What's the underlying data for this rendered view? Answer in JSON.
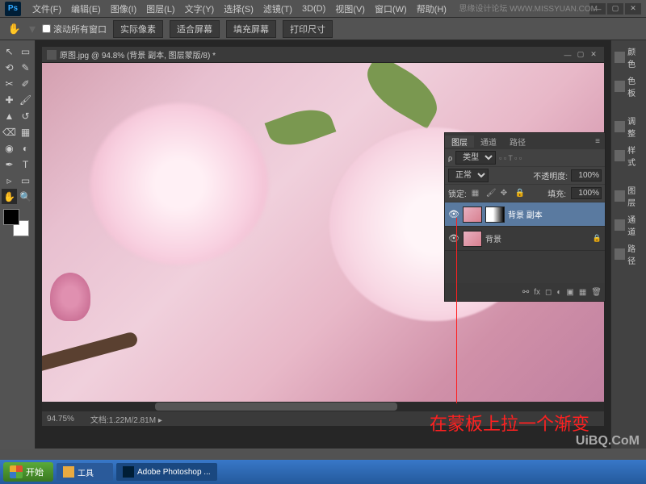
{
  "app": {
    "logo": "Ps"
  },
  "menu": {
    "file": "文件(F)",
    "edit": "编辑(E)",
    "image": "图像(I)",
    "layer": "图层(L)",
    "type": "文字(Y)",
    "select": "选择(S)",
    "filter": "滤镜(T)",
    "threed": "3D(D)",
    "view": "视图(V)",
    "window": "窗口(W)",
    "help": "帮助(H)"
  },
  "watermark_top": "思缘设计论坛 WWW.MISSYUAN.COM",
  "options": {
    "scroll_all": "滚动所有窗口",
    "actual_pixels": "实际像素",
    "fit_screen": "适合屏幕",
    "fill_screen": "填充屏幕",
    "print_size": "打印尺寸"
  },
  "document": {
    "title": "原图.jpg @ 94.8% (背景 副本, 图层蒙版/8) *",
    "zoom": "94.75%",
    "docsize_label": "文档:",
    "docsize": "1.22M/2.81M"
  },
  "dock": {
    "color": "颜色",
    "swatches": "色板",
    "adjust": "调整",
    "styles": "样式",
    "layers": "图层",
    "channels": "通道",
    "paths": "路径"
  },
  "layers_panel": {
    "tabs": {
      "layers": "图层",
      "channels": "通道",
      "paths": "路径"
    },
    "type_filter_label": "类型",
    "blend_mode": "正常",
    "opacity_label": "不透明度:",
    "opacity_value": "100%",
    "lock_label": "锁定:",
    "fill_label": "填充:",
    "fill_value": "100%",
    "layer1": "背景 副本",
    "layer2": "背景"
  },
  "annotation": "在蒙板上拉一个渐变",
  "uibq": "UiBQ.CoM",
  "taskbar": {
    "start": "开始",
    "tools": "工具",
    "photoshop": "Adobe Photoshop ..."
  }
}
